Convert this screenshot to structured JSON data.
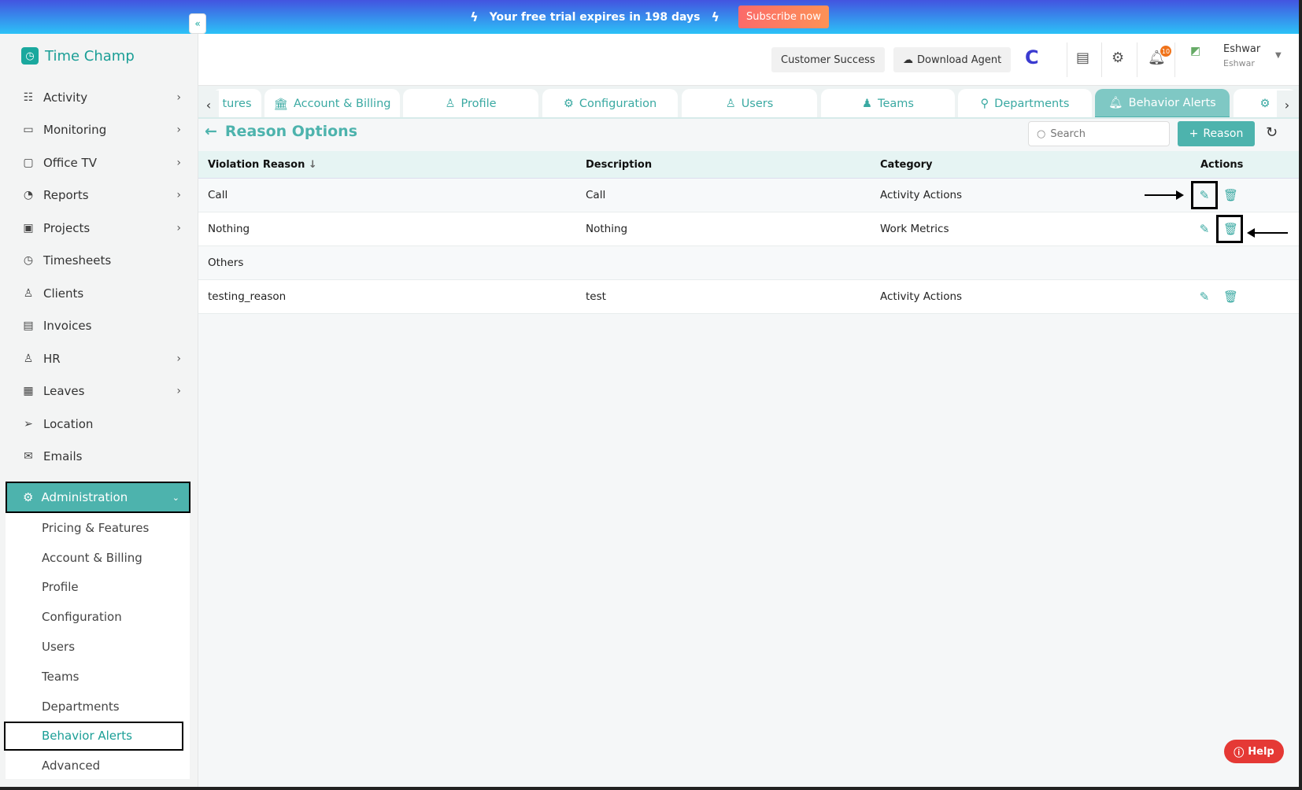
{
  "banner": {
    "text": "Your free trial expires in 198 days",
    "subscribe": "Subscribe now"
  },
  "app": {
    "name": "Time Champ",
    "collapse": "«"
  },
  "sidebar": {
    "items": [
      {
        "label": "Activity",
        "icon": "activity-icon",
        "glyph": "☷",
        "chev": true
      },
      {
        "label": "Monitoring",
        "icon": "monitor-icon",
        "glyph": "▭",
        "chev": true
      },
      {
        "label": "Office TV",
        "icon": "tv-icon",
        "glyph": "▢",
        "chev": true
      },
      {
        "label": "Reports",
        "icon": "pie-chart-icon",
        "glyph": "◔",
        "chev": true
      },
      {
        "label": "Projects",
        "icon": "briefcase-icon",
        "glyph": "▣",
        "chev": true
      },
      {
        "label": "Timesheets",
        "icon": "alarm-icon",
        "glyph": "◷",
        "chev": false
      },
      {
        "label": "Clients",
        "icon": "user-icon",
        "glyph": "♙",
        "chev": false
      },
      {
        "label": "Invoices",
        "icon": "invoice-icon",
        "glyph": "▤",
        "chev": false
      },
      {
        "label": "HR",
        "icon": "person-icon",
        "glyph": "♙",
        "chev": true
      },
      {
        "label": "Leaves",
        "icon": "calendar-icon",
        "glyph": "▦",
        "chev": true
      },
      {
        "label": "Location",
        "icon": "location-arrow-icon",
        "glyph": "➢",
        "chev": false
      },
      {
        "label": "Emails",
        "icon": "mail-icon",
        "glyph": "✉",
        "chev": false
      }
    ],
    "admin": "Administration",
    "submenu": [
      "Pricing & Features",
      "Account & Billing",
      "Profile",
      "Configuration",
      "Users",
      "Teams",
      "Departments",
      "Behavior Alerts",
      "Advanced"
    ]
  },
  "header": {
    "customer_success": "Customer Success",
    "download_agent": "Download Agent",
    "notifications": "10",
    "user_name": "Eshwar",
    "user_role": "Eshwar"
  },
  "tabs": [
    "tures",
    "Account & Billing",
    "Profile",
    "Configuration",
    "Users",
    "Teams",
    "Departments",
    "Behavior Alerts"
  ],
  "page": {
    "title": "Reason Options",
    "search_placeholder": "Search",
    "add_label": "Reason",
    "help": "Help"
  },
  "table": {
    "headers": [
      "Violation Reason",
      "Description",
      "Category",
      "Actions"
    ],
    "rows": [
      {
        "reason": "Call",
        "description": "Call",
        "category": "Activity Actions",
        "actions": true
      },
      {
        "reason": "Nothing",
        "description": "Nothing",
        "category": "Work Metrics",
        "actions": true
      },
      {
        "reason": "Others",
        "description": "",
        "category": "",
        "actions": false
      },
      {
        "reason": "testing_reason",
        "description": "test",
        "category": "Activity Actions",
        "actions": true
      }
    ]
  },
  "colors": {
    "accent": "#4db3ad",
    "admin_bg": "#4db3ad",
    "help": "#e53935"
  }
}
